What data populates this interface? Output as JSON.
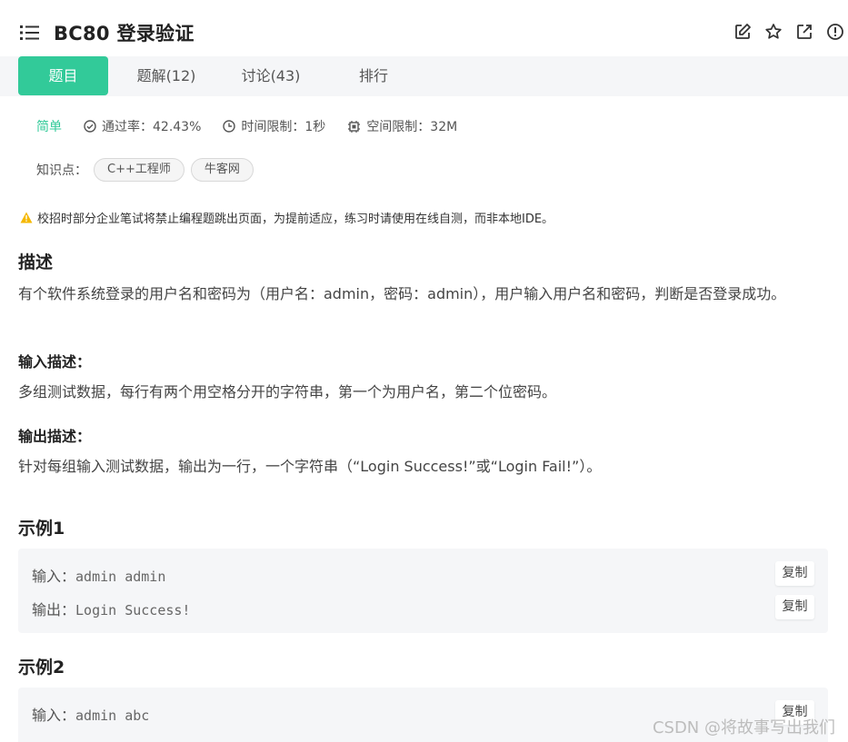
{
  "header": {
    "title": "BC80  登录验证",
    "icons": [
      "list-icon",
      "edit-icon",
      "star-icon",
      "external-link-icon",
      "info-icon"
    ]
  },
  "tabs": [
    {
      "label": "题目",
      "active": true
    },
    {
      "label": "题解(12)",
      "active": false
    },
    {
      "label": "讨论(43)",
      "active": false
    },
    {
      "label": "排行",
      "active": false
    }
  ],
  "meta": {
    "difficulty": "简单",
    "pass_rate": "通过率：42.43%",
    "time_limit": "时间限制：1秒",
    "space_limit": "空间限制：32M"
  },
  "knowledge": {
    "label": "知识点：",
    "tags": [
      "C++工程师",
      "牛客网"
    ]
  },
  "warning": "校招时部分企业笔试将禁止编程题跳出页面，为提前适应，练习时请使用在线自测，而非本地IDE。",
  "description": {
    "heading": "描述",
    "text": "有个软件系统登录的用户名和密码为（用户名：admin，密码：admin），用户输入用户名和密码，判断是否登录成功。"
  },
  "input_desc": {
    "heading": "输入描述：",
    "text": "多组测试数据，每行有两个用空格分开的字符串，第一个为用户名，第二个位密码。"
  },
  "output_desc": {
    "heading": "输出描述：",
    "text": "针对每组输入测试数据，输出为一行，一个字符串（“Login Success!”或“Login Fail!”）。"
  },
  "examples": [
    {
      "heading": "示例1",
      "input_label": "输入：",
      "input": "admin admin",
      "output_label": "输出：",
      "output": "Login Success!",
      "copy_label": "复制"
    },
    {
      "heading": "示例2",
      "input_label": "输入：",
      "input": "admin abc",
      "copy_label": "复制"
    }
  ],
  "watermark": "CSDN @将故事写出我们",
  "colors": {
    "accent": "#32ca99",
    "warning": "#f5b800"
  }
}
